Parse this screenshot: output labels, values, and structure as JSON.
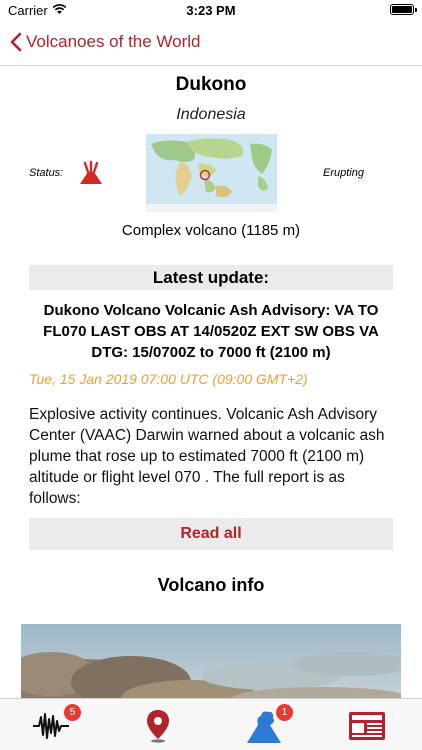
{
  "status_bar": {
    "carrier": "Carrier",
    "time": "3:23 PM"
  },
  "nav": {
    "back_label": "Volcanoes of the World"
  },
  "volcano": {
    "name": "Dukono",
    "country": "Indonesia",
    "status_label": "Status:",
    "status_value": "Erupting",
    "type": "Complex volcano (1185 m)"
  },
  "latest": {
    "heading": "Latest update:",
    "headline": "Dukono Volcano Volcanic Ash Advisory: VA TO FL070 LAST OBS AT 14/0520Z EXT SW OBS VA DTG: 15/0700Z to 7000 ft (2100 m)",
    "date": "Tue, 15 Jan 2019 07:00 UTC (09:00 GMT+2)",
    "body": "Explosive activity continues. Volcanic Ash Advisory Center (VAAC) Darwin warned about a volcanic ash plume that rose up to estimated 7000 ft (2100 m) altitude or flight level 070 . The full report is as follows:",
    "read_all": "Read all"
  },
  "info": {
    "heading": "Volcano info"
  },
  "tabbar": {
    "tabs": [
      {
        "name": "earthquakes",
        "badge": "5"
      },
      {
        "name": "map",
        "badge": ""
      },
      {
        "name": "volcanoes",
        "badge": "1"
      },
      {
        "name": "news",
        "badge": ""
      }
    ]
  },
  "colors": {
    "accent": "#b0242b",
    "date": "#f0a030",
    "badge": "#e53b35",
    "tab_active": "#2e7bd6"
  }
}
